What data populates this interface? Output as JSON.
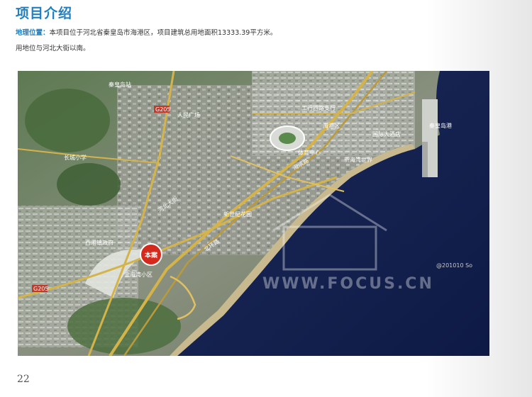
{
  "header": {
    "title": "项目介绍"
  },
  "description": {
    "label": "地理位置：",
    "line1": "本项目位于河北省秦皇岛市海港区，项目建筑总用地面积13333.39平方米。",
    "line2": "用地位与河北大街以南。"
  },
  "map": {
    "site_marker": "本案",
    "watermark": "WWW.FOCUS.CN",
    "copyright": "@201010 So",
    "labels": [
      {
        "id": "l1",
        "text": "秦皇岛站"
      },
      {
        "id": "l2",
        "text": "G205"
      },
      {
        "id": "l3",
        "text": "人民广场"
      },
      {
        "id": "l4",
        "text": "工行西路支行"
      },
      {
        "id": "l5",
        "text": "体育中心"
      },
      {
        "id": "l6",
        "text": "海港区"
      },
      {
        "id": "l7",
        "text": "国际大酒店"
      },
      {
        "id": "l8",
        "text": "秦皇岛港"
      },
      {
        "id": "l9",
        "text": "长城小学"
      },
      {
        "id": "l10",
        "text": "河北大街"
      },
      {
        "id": "l11",
        "text": "海滨路"
      },
      {
        "id": "l12",
        "text": "新世纪花园"
      },
      {
        "id": "l13",
        "text": "北环路"
      },
      {
        "id": "l14",
        "text": "西港镇政府"
      },
      {
        "id": "l15",
        "text": "金海湾小区"
      },
      {
        "id": "l16",
        "text": "新海湾世界"
      },
      {
        "id": "l17",
        "text": "G205"
      }
    ]
  },
  "footer": {
    "page_number": "22"
  }
}
